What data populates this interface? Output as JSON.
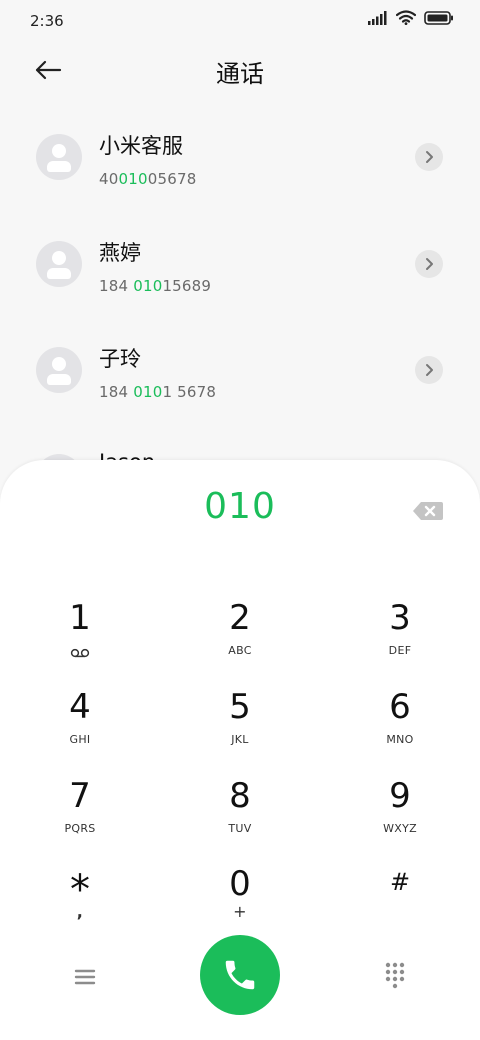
{
  "status_bar": {
    "time": "2:36",
    "icons": [
      "signal-icon",
      "wifi-icon",
      "battery-icon"
    ]
  },
  "header": {
    "title": "通话",
    "back_icon": "arrow-left-icon"
  },
  "contacts": [
    {
      "name": "小米客服",
      "number_pre": "40",
      "number_match": "010",
      "number_post": "05678"
    },
    {
      "name": "燕婷",
      "number_pre": "184 ",
      "number_match": "010",
      "number_post": "15689"
    },
    {
      "name": "子玲",
      "number_pre": "184 ",
      "number_match": "010",
      "number_post": "1 5678"
    },
    {
      "name": "Jason",
      "number_pre": "",
      "number_match": "",
      "number_post": ""
    }
  ],
  "dialpad": {
    "input_value": "010",
    "keys": [
      {
        "digit": "1",
        "letters": ""
      },
      {
        "digit": "2",
        "letters": "ABC"
      },
      {
        "digit": "3",
        "letters": "DEF"
      },
      {
        "digit": "4",
        "letters": "GHI"
      },
      {
        "digit": "5",
        "letters": "JKL"
      },
      {
        "digit": "6",
        "letters": "MNO"
      },
      {
        "digit": "7",
        "letters": "PQRS"
      },
      {
        "digit": "8",
        "letters": "TUV"
      },
      {
        "digit": "9",
        "letters": "WXYZ"
      },
      {
        "digit": "*",
        "letters": ","
      },
      {
        "digit": "0",
        "letters": "+"
      },
      {
        "digit": "#",
        "letters": ""
      }
    ]
  },
  "colors": {
    "accent": "#1bbd5a",
    "background": "#f7f7f7",
    "panel": "#ffffff"
  }
}
